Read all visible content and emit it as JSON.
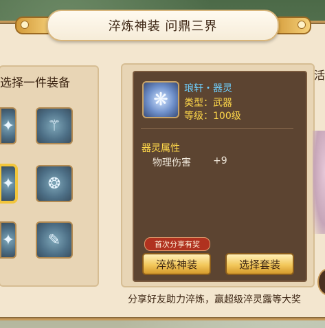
{
  "title": "淬炼神装  问鼎三界",
  "left_panel": {
    "heading": "选择一件装备",
    "items": [
      {
        "icon": "gem-icon"
      },
      {
        "icon": "staff-icon"
      },
      {
        "icon": "gem-icon"
      },
      {
        "icon": "ring-icon"
      },
      {
        "icon": "gem-icon"
      },
      {
        "icon": "scroll-icon"
      }
    ]
  },
  "equipment": {
    "name": "琅轩・器灵",
    "type_label": "类型：武器",
    "level_label": "等级：100级",
    "attr_heading": "器灵属性",
    "attr_name": "物理伤害",
    "attr_value": "+9"
  },
  "share_badge": "首次分享有奖",
  "buttons": {
    "refine": "淬炼神装",
    "select_set": "选择套装"
  },
  "side_text": "活",
  "footer": "分享好友助力淬炼，赢超级淬灵露等大奖",
  "colors": {
    "accent": "#f2c53a",
    "name": "#6fd0ff",
    "highlight": "#ffd84a",
    "badge": "#b0321f"
  }
}
